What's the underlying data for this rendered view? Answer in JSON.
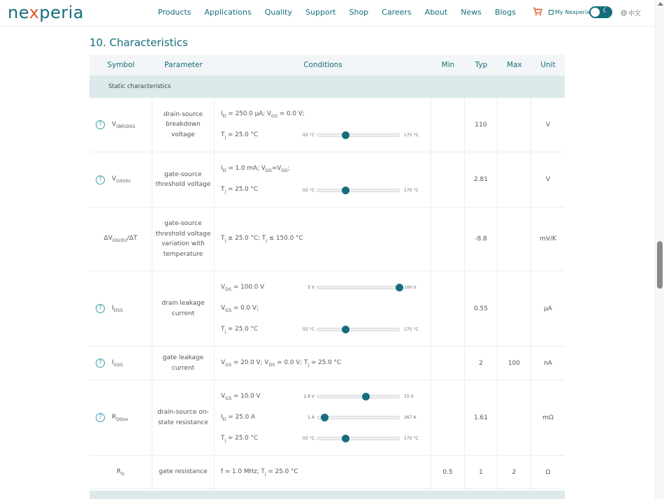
{
  "header": {
    "logo": {
      "pre": "ne",
      "x": "x",
      "post": "peria"
    },
    "nav": [
      "Products",
      "Applications",
      "Quality",
      "Support",
      "Shop",
      "Careers",
      "About",
      "News",
      "Blogs"
    ],
    "cart_icon": "cart-icon",
    "my_nexperia": "My Nexperia",
    "theme_toggle": {
      "mode": "light",
      "icon": "moon-icon"
    },
    "language": "中文"
  },
  "section_title": "10. Characteristics",
  "table": {
    "columns": [
      "Symbol",
      "Parameter",
      "Conditions",
      "Min",
      "Typ",
      "Max",
      "Unit"
    ],
    "group": "Static characteristics",
    "rows": [
      {
        "has_help": true,
        "symbol": {
          "base": "V",
          "sub": "(BR)DSS",
          "suffix": ""
        },
        "parameter": "drain-source breakdown voltage",
        "conditions": [
          {
            "text": "I<sub>D</sub> = 250.0 μA; V<sub>GS</sub> = 0.0 V;"
          },
          {
            "text": "T<sub>j</sub> = 25.0 °C",
            "slider": {
              "min_label": "-55 °C",
              "max_label": "175 °C",
              "min": -55,
              "max": 175,
              "value": 25
            }
          }
        ],
        "min": "",
        "typ": "110",
        "max": "",
        "unit": "V"
      },
      {
        "has_help": true,
        "symbol": {
          "base": "V",
          "sub": "GS(th)",
          "suffix": ""
        },
        "parameter": "gate-source threshold voltage",
        "conditions": [
          {
            "text": "I<sub>D</sub> = 1.0 mA; V<sub>DS</sub>=V<sub>GS</sub>;"
          },
          {
            "text": "T<sub>j</sub> = 25.0 °C",
            "slider": {
              "min_label": "-55 °C",
              "max_label": "175 °C",
              "min": -55,
              "max": 175,
              "value": 25
            }
          }
        ],
        "min": "",
        "typ": "2.81",
        "max": "",
        "unit": "V"
      },
      {
        "has_help": false,
        "symbol": {
          "base": "ΔV",
          "sub": "GS(th)",
          "suffix": "/ΔT"
        },
        "parameter": "gate-source threshold voltage variation with temperature",
        "conditions": [
          {
            "text": "T<sub>j</sub> ≥ 25.0 °C; T<sub>j</sub> ≤ 150.0 °C"
          }
        ],
        "min": "",
        "typ": "-8.8",
        "max": "",
        "unit": "mV/K"
      },
      {
        "has_help": true,
        "symbol": {
          "base": "I",
          "sub": "DSS",
          "suffix": ""
        },
        "parameter": "drain leakage current",
        "conditions": [
          {
            "text": "V<sub>DS</sub> = 100.0 V",
            "slider": {
              "min_label": "5 V",
              "max_label": "100 V",
              "min": 5,
              "max": 100,
              "value": 100
            }
          },
          {
            "text": "V<sub>GS</sub> = 0.0 V;"
          },
          {
            "text": "T<sub>j</sub> = 25.0 °C",
            "slider": {
              "min_label": "-55 °C",
              "max_label": "175 °C",
              "min": -55,
              "max": 175,
              "value": 25
            }
          }
        ],
        "min": "",
        "typ": "0.55",
        "max": "",
        "unit": "μA"
      },
      {
        "has_help": true,
        "symbol": {
          "base": "I",
          "sub": "GSS",
          "suffix": ""
        },
        "parameter": "gate leakage current",
        "conditions": [
          {
            "text": "V<sub>GS</sub> = 20.0 V; V<sub>DS</sub> = 0.0 V; T<sub>j</sub> = 25.0 °C"
          }
        ],
        "min": "",
        "typ": "2",
        "max": "100",
        "unit": "nA"
      },
      {
        "has_help": true,
        "symbol": {
          "base": "R",
          "sub": "DSon",
          "suffix": ""
        },
        "parameter": "drain-source on-state resistance",
        "conditions": [
          {
            "text": "V<sub>GS</sub> = 10.0 V",
            "slider": {
              "min_label": "2.8 V",
              "max_label": "15 V",
              "min": 2.8,
              "max": 15,
              "value": 10
            }
          },
          {
            "text": "I<sub>D</sub> = 25.0 A",
            "slider": {
              "min_label": "1 A",
              "max_label": "267 A",
              "min": 1,
              "max": 267,
              "value": 25
            }
          },
          {
            "text": "T<sub>j</sub> = 25.0 °C",
            "slider": {
              "min_label": "-55 °C",
              "max_label": "175 °C",
              "min": -55,
              "max": 175,
              "value": 25
            }
          }
        ],
        "min": "",
        "typ": "1.61",
        "max": "",
        "unit": "mΩ"
      },
      {
        "has_help": false,
        "symbol": {
          "base": "R",
          "sub": "G",
          "suffix": ""
        },
        "parameter": "gate resistance",
        "conditions": [
          {
            "text": "f = 1.0 MHz; T<sub>j</sub> = 25.0 °C"
          }
        ],
        "min": "0.5",
        "typ": "1",
        "max": "2",
        "unit": "Ω"
      }
    ]
  },
  "colors": {
    "brand": "#156d7c",
    "accent": "#e8562a",
    "group_bg": "#dceaec",
    "header_bg": "#f3f6f8"
  }
}
